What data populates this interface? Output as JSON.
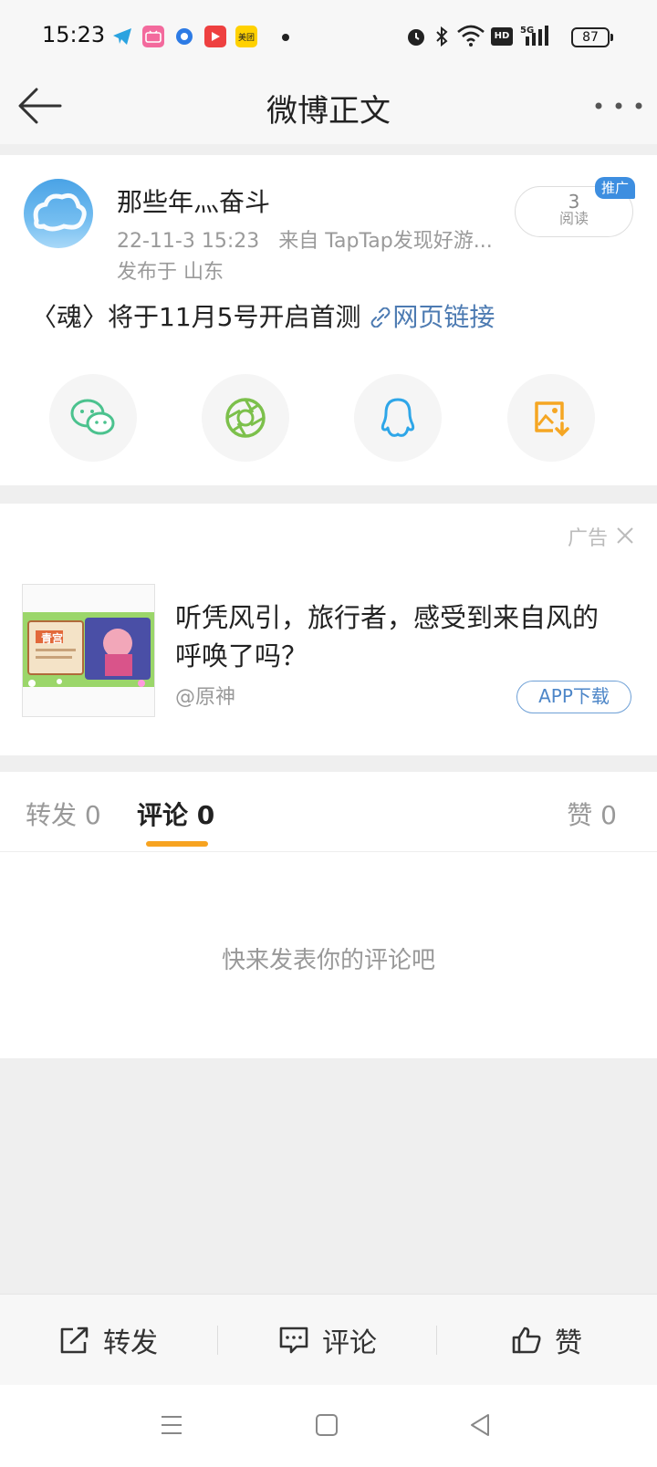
{
  "status_bar": {
    "time": "15:23",
    "battery": "87",
    "apps": [
      "telegram-icon",
      "bilibili-icon",
      "browser-icon",
      "video-icon",
      "meituan-icon"
    ],
    "meituan_label": "美团"
  },
  "header": {
    "title": "微博正文"
  },
  "post": {
    "username": "那些年灬奋斗",
    "timestamp": "22-11-3 15:23",
    "source": "来自 TapTap发现好游...",
    "location": "发布于 山东",
    "read_count": "3",
    "read_label": "阅读",
    "promo_badge": "推广",
    "text": "〈魂〉将于11月5号开启首测",
    "link_text": "网页链接"
  },
  "share_buttons": [
    "wechat-icon",
    "moments-icon",
    "qq-icon",
    "save-image-icon"
  ],
  "ad": {
    "label": "广告",
    "title": "听凭风引，旅行者，感受到来自风的呼唤了吗？",
    "source": "@原神",
    "button": "APP下载",
    "image_badge": "青宫"
  },
  "tabs": {
    "repost": "转发 0",
    "comment": "评论 0",
    "like": "赞 0"
  },
  "comments": {
    "empty_text": "快来发表你的评论吧"
  },
  "toolbar": {
    "repost": "转发",
    "comment": "评论",
    "like": "赞"
  },
  "colors": {
    "accent_orange": "#f7a320",
    "link_blue": "#4d7bb2",
    "promo_blue": "#3d8ee0"
  }
}
